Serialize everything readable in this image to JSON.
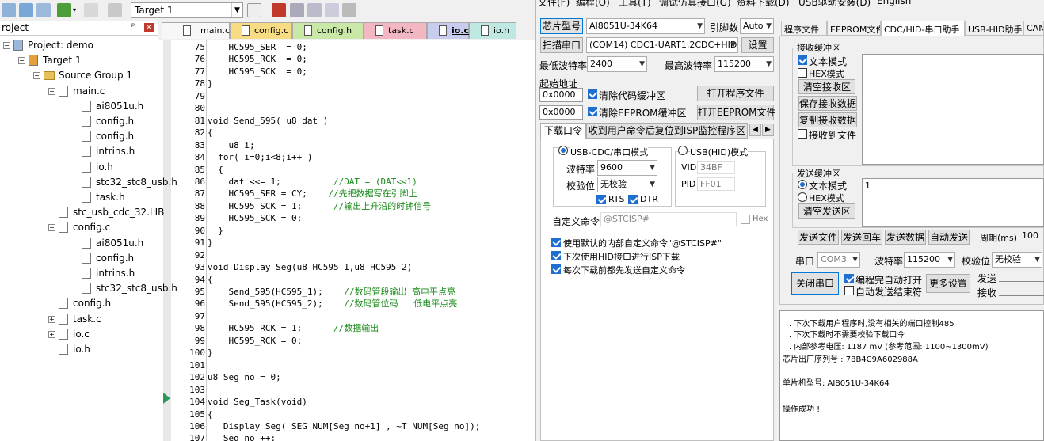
{
  "toolbar": {
    "target": "Target 1"
  },
  "project": {
    "header": "roject",
    "pin": "ᵖ",
    "close": "×",
    "items": [
      {
        "label": "Project: demo",
        "depth": 0
      },
      {
        "label": "Target 1",
        "depth": 1
      },
      {
        "label": "Source Group 1",
        "depth": 2
      },
      {
        "label": "main.c",
        "depth": 3
      },
      {
        "label": "ai8051u.h",
        "depth": 4
      },
      {
        "label": "config.h",
        "depth": 4
      },
      {
        "label": "config.h",
        "depth": 4
      },
      {
        "label": "intrins.h",
        "depth": 4
      },
      {
        "label": "io.h",
        "depth": 4
      },
      {
        "label": "stc32_stc8_usb.h",
        "depth": 4
      },
      {
        "label": "task.h",
        "depth": 4
      },
      {
        "label": "stc_usb_cdc_32.LIB",
        "depth": 3
      },
      {
        "label": "config.c",
        "depth": 3
      },
      {
        "label": "ai8051u.h",
        "depth": 4
      },
      {
        "label": "config.h",
        "depth": 4
      },
      {
        "label": "intrins.h",
        "depth": 4
      },
      {
        "label": "stc32_stc8_usb.h",
        "depth": 4
      },
      {
        "label": "config.h",
        "depth": 3
      },
      {
        "label": "task.c",
        "depth": 3
      },
      {
        "label": "io.c",
        "depth": 3
      },
      {
        "label": "io.h",
        "depth": 3
      }
    ]
  },
  "tabs": [
    {
      "label": "main.c",
      "color": "#f7f7f7"
    },
    {
      "label": "config.c",
      "color": "#f7dc83"
    },
    {
      "label": "config.h",
      "color": "#c9e8a7"
    },
    {
      "label": "task.c",
      "color": "#f2b7c3"
    },
    {
      "label": "io.c",
      "color": "#c8cdf0"
    },
    {
      "label": "io.h",
      "color": "#bfe8e3"
    }
  ],
  "code": [
    {
      "n": "75",
      "t": "    HC595_SER  = 0;"
    },
    {
      "n": "76",
      "t": "    HC595_RCK  = 0;"
    },
    {
      "n": "77",
      "t": "    HC595_SCK  = 0;"
    },
    {
      "n": "78",
      "t": "}"
    },
    {
      "n": "79",
      "t": ""
    },
    {
      "n": "80",
      "t": ""
    },
    {
      "n": "81",
      "t": "void Send_595( u8 dat )"
    },
    {
      "n": "82",
      "t": "{"
    },
    {
      "n": "83",
      "t": "    u8 i;"
    },
    {
      "n": "84",
      "t": "  for( i=0;i<8;i++ )"
    },
    {
      "n": "85",
      "t": "  {"
    },
    {
      "n": "86",
      "t": "    dat <<= 1;",
      "c": "          //DAT = (DAT<<1)"
    },
    {
      "n": "87",
      "t": "    HC595_SER = CY;",
      "c": "    //先把数据写在引脚上"
    },
    {
      "n": "88",
      "t": "    HC595_SCK = 1;",
      "c": "      //输出上升沿的时钟信号"
    },
    {
      "n": "89",
      "t": "    HC595_SCK = 0;"
    },
    {
      "n": "90",
      "t": "  }"
    },
    {
      "n": "91",
      "t": "}"
    },
    {
      "n": "92",
      "t": ""
    },
    {
      "n": "93",
      "t": "void Display_Seg(u8 HC595_1,u8 HC595_2)"
    },
    {
      "n": "94",
      "t": "{"
    },
    {
      "n": "95",
      "t": "    Send_595(HC595_1);",
      "c": "    //数码管段输出 高电平点亮"
    },
    {
      "n": "96",
      "t": "    Send_595(HC595_2);",
      "c": "    //数码管位码   低电平点亮"
    },
    {
      "n": "97",
      "t": ""
    },
    {
      "n": "98",
      "t": "    HC595_RCK = 1;",
      "c": "      //数据输出"
    },
    {
      "n": "99",
      "t": "    HC595_RCK = 0;"
    },
    {
      "n": "100",
      "t": "}"
    },
    {
      "n": "101",
      "t": ""
    },
    {
      "n": "102",
      "t": "u8 Seg_no = 0;"
    },
    {
      "n": "103",
      "t": ""
    },
    {
      "n": "104",
      "t": "void Seg_Task(void)"
    },
    {
      "n": "105",
      "t": "{"
    },
    {
      "n": "106",
      "t": "   Display_Seg( SEG_NUM[Seg_no+1] , ~T_NUM[Seg_no]);"
    },
    {
      "n": "107",
      "t": "   Seg no ++;"
    }
  ],
  "isp": {
    "menu": [
      "文件(F)",
      "编程(O)",
      "工具(T)",
      "调试仿真接口(G)",
      "USB驱动安装(D)",
      "资料下载(D)",
      "English"
    ],
    "chip_type_btn": "芯片型号",
    "chip_type": "AI8051U-34K64",
    "pins_label": "引脚数",
    "pins": "Auto",
    "scan_btn": "扫描串口",
    "com_port": "(COM14) CDC1-UART1,2CDC+HID",
    "settings_btn": "设置",
    "min_baud_label": "最低波特率",
    "min_baud": "2400",
    "max_baud_label": "最高波特率",
    "max_baud": "115200",
    "start_addr_label": "起始地址",
    "addr1": "0x0000",
    "clear_code": "清除代码缓冲区",
    "open_prog": "打开程序文件",
    "addr2": "0x0000",
    "clear_eeprom": "清除EEPROM缓冲区",
    "open_eeprom": "打开EEPROM文件",
    "dl_tab1": "下载口令",
    "dl_tab2": "收到用户命令后复位到ISP监控程序区",
    "usb_cdc_mode": "USB-CDC/串口模式",
    "usb_hid_mode": "USB(HID)模式",
    "baud_label": "波特率",
    "baud": "9600",
    "parity_label": "校验位",
    "parity": "无校验",
    "rts": "RTS",
    "dtr": "DTR",
    "vid_label": "VID",
    "vid": "34BF",
    "pid_label": "PID",
    "pid": "FF01",
    "custom_cmd_label": "自定义命令",
    "custom_cmd": "@STCISP#",
    "hex_label": "Hex",
    "opt1": "使用默认的内部自定义命令\"@STCISP#\"",
    "opt2": "下次使用HID接口进行ISP下载",
    "opt3": "每次下载前都先发送自定义命令",
    "right_tabs": [
      "程序文件",
      "EEPROM文件",
      "CDC/HID-串口助手",
      "USB-HID助手",
      "CAN"
    ],
    "recv_title": "接收缓冲区",
    "recv_text_mode": "文本模式",
    "recv_hex_mode": "HEX模式",
    "clear_recv": "清空接收区",
    "save_recv": "保存接收数据",
    "copy_recv": "复制接收数据",
    "recv_to_file": "接收到文件",
    "send_title": "发送缓冲区",
    "send_text_mode": "文本模式",
    "send_hex_mode": "HEX模式",
    "clear_send": "清空发送区",
    "send_content": "1",
    "send_file": "发送文件",
    "send_enter": "发送回车",
    "send_data": "发送数据",
    "auto_send": "自动发送",
    "period_label": "周期(ms)",
    "period": "100",
    "port_label": "串口",
    "port": "COM3",
    "baud2_label": "波特率",
    "baud2": "115200",
    "parity2_label": "校验位",
    "parity2": "无校验",
    "close_port": "关闭串口",
    "auto_open": "编程完自动打开",
    "auto_send_end": "自动发送结束符",
    "more_settings": "更多设置",
    "send_stat": "发送",
    "recv_stat": "接收",
    "log": [
      ". 下次下载用户程序时,没有相关的端口控制485",
      ". 下次下载时不需要校验下载口令",
      ". 内部参考电压: 1187 mV (参考范围: 1100~1300mV)",
      "芯片出厂序列号 : 78B4C9A602988A",
      "",
      " 单片机型号: AI8051U-34K64",
      "",
      "操作成功 !"
    ]
  }
}
